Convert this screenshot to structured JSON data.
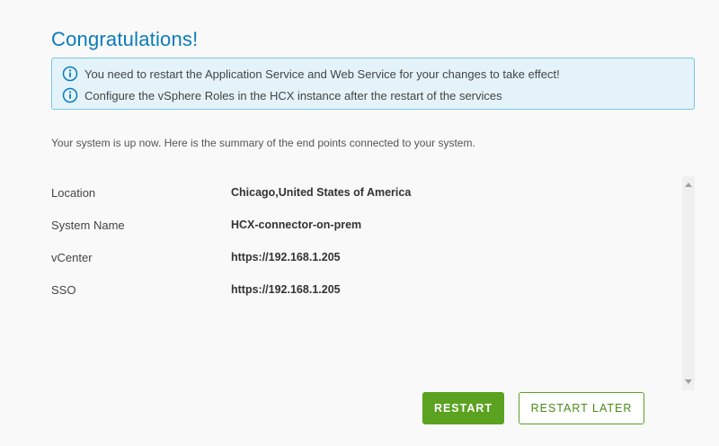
{
  "header": {
    "title": "Congratulations!"
  },
  "alert": {
    "messages": [
      "You need to restart the Application Service and Web Service for your changes to take effect!",
      "Configure the vSphere Roles in the HCX instance after the restart of the services"
    ],
    "icon": "info-icon",
    "accent": "#0a7bbd"
  },
  "summary": {
    "text": "Your system is up now. Here is the summary of the end points connected to your system."
  },
  "details": [
    {
      "label": "Location",
      "value": "Chicago,United States of America"
    },
    {
      "label": "System Name",
      "value": "HCX-connector-on-prem"
    },
    {
      "label": "vCenter",
      "value": "https://192.168.1.205"
    },
    {
      "label": "SSO",
      "value": "https://192.168.1.205"
    }
  ],
  "actions": {
    "restart_label": "RESTART",
    "restart_later_label": "RESTART LATER",
    "primary_color": "#5aa220"
  }
}
